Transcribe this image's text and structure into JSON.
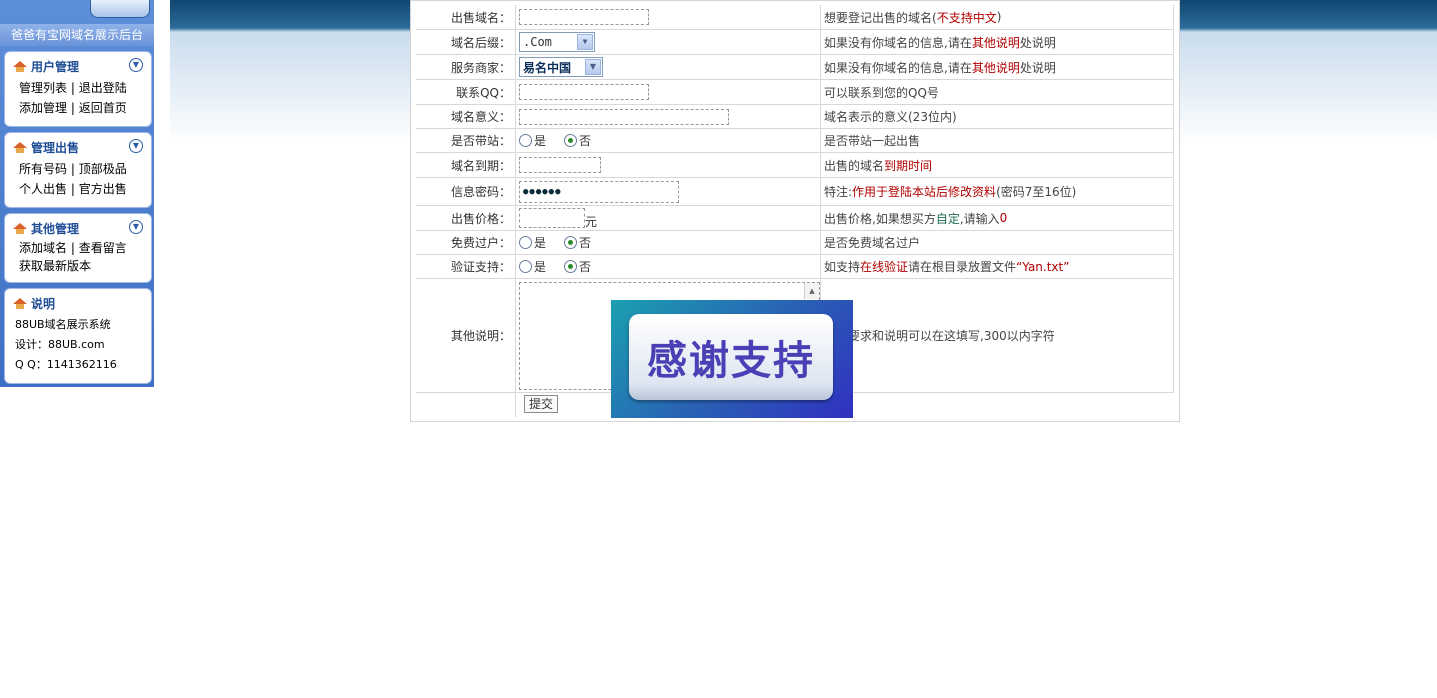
{
  "sidebar": {
    "title": "爸爸有宝网域名展示后台",
    "sections": [
      {
        "title": "用户管理",
        "links": [
          "管理列表",
          "退出登陆",
          "添加管理",
          "返回首页"
        ]
      },
      {
        "title": "管理出售",
        "links": [
          "所有号码",
          "顶部极品",
          "个人出售",
          "官方出售"
        ]
      },
      {
        "title": "其他管理",
        "links": [
          "添加域名",
          "查看留言",
          "获取最新版本"
        ]
      }
    ],
    "info": {
      "title": "说明",
      "line1": "88UB域名展示系统",
      "line2": "设计：88UB.com",
      "line3": "Q  Q：1141362116"
    }
  },
  "form": {
    "separator": "|",
    "rows": {
      "domain": {
        "label": "出售域名：",
        "value": "",
        "desc_a": "想要登记出售的域名(",
        "desc_red": "不支持中文",
        "desc_b": ")"
      },
      "suffix": {
        "label": "域名后缀：",
        "value": ".Com",
        "desc_a": "如果没有你域名的信息,请在",
        "desc_red": "其他说明",
        "desc_b": "处说明"
      },
      "registrar": {
        "label": "服务商家：",
        "value": "易名中国",
        "desc_a": "如果没有你域名的信息,请在",
        "desc_red": "其他说明",
        "desc_b": "处说明"
      },
      "qq": {
        "label": "联系QQ：",
        "value": "",
        "desc": "可以联系到您的QQ号"
      },
      "meaning": {
        "label": "域名意义：",
        "value": "",
        "desc": "域名表示的意义(23位内)"
      },
      "with_site": {
        "label": "是否带站：",
        "opt_yes": "是",
        "opt_no": "否",
        "selected": "否",
        "desc": "是否带站一起出售"
      },
      "expiry": {
        "label": "域名到期：",
        "value": "",
        "desc_a": "出售的域名",
        "desc_red": "到期时间"
      },
      "password": {
        "label": "信息密码：",
        "value": "●●●●●●",
        "desc_a": "特注:",
        "desc_red": "作用于登陆本站后修改资料",
        "desc_b": "(密码7至16位)"
      },
      "price": {
        "label": "出售价格：",
        "value": "",
        "unit": "元",
        "desc_a": "出售价格,如果想买方",
        "desc_green": "自定",
        "desc_b": ",请输入",
        "desc_red": "0"
      },
      "free_transfer": {
        "label": "免费过户：",
        "opt_yes": "是",
        "opt_no": "否",
        "selected": "否",
        "desc": "是否免费域名过户"
      },
      "verify": {
        "label": "验证支持：",
        "opt_yes": "是",
        "opt_no": "否",
        "selected": "否",
        "desc_a": "如支持",
        "desc_red": "在线验证",
        "desc_b": "请在根目录放置文件 ",
        "desc_file": "“Yan.txt”"
      },
      "notes": {
        "label": "其他说明：",
        "value": "",
        "desc": "其他要求和说明可以在这填写,300以内字符"
      }
    },
    "submit_label": "提交"
  },
  "banner": {
    "text": "感谢支持"
  },
  "colors": {
    "accent_red": "#b20000",
    "sidebar_blue": "#3f6fc4",
    "banner_text": "#4a3fb5"
  }
}
